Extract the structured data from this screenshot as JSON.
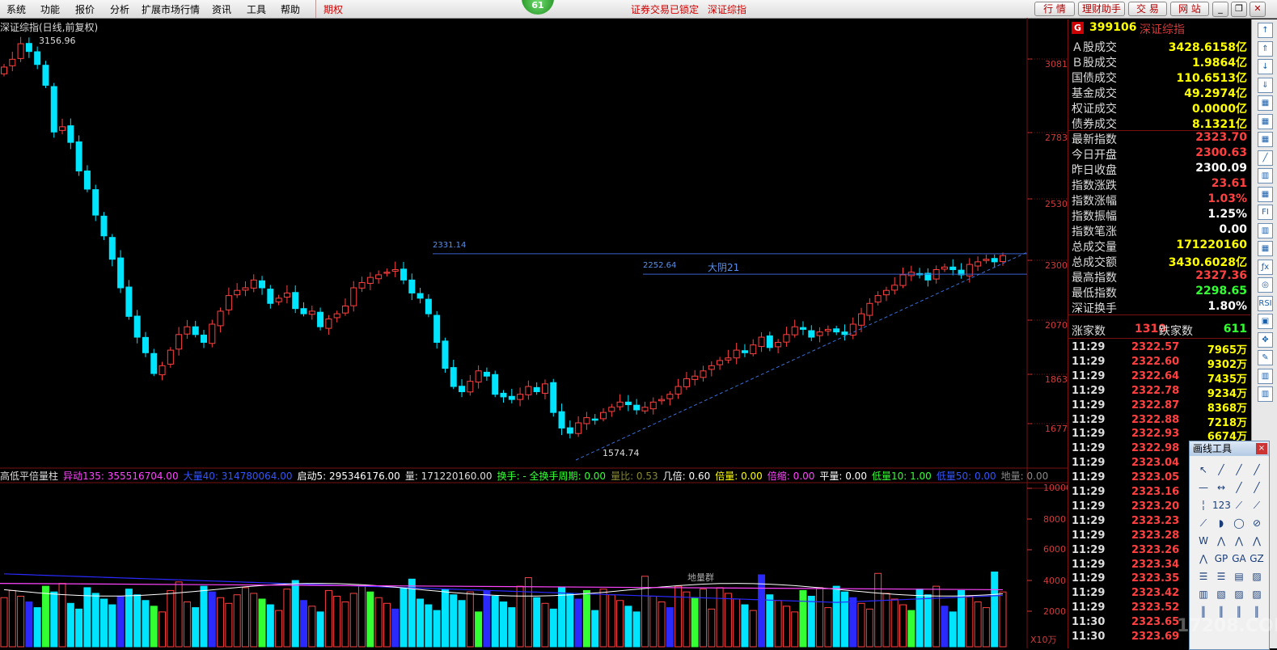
{
  "menu": {
    "items": [
      "系统",
      "功能",
      "报价",
      "分析",
      "扩展市场行情",
      "资讯",
      "工具",
      "帮助"
    ],
    "active_item": "期权",
    "badge": "61",
    "status_locked": "证券交易已锁定",
    "status_index": "深证综指",
    "buttons": [
      "行 情",
      "理财助手",
      "交 易",
      "网 站"
    ]
  },
  "chart": {
    "title": "深证综指(日线,前复权)",
    "max_label": "3156.96",
    "min_label": "1574.74",
    "level1_label": "2331.14",
    "level2_label": "2252.64",
    "pattern_label": "大阴21",
    "price_axis": [
      "3081",
      "2783",
      "2530",
      "2300",
      "2070",
      "1863",
      "1677"
    ],
    "colors": {
      "up": "#ff4040",
      "down": "#00e5ff",
      "level_line": "#3a5fcd",
      "trend_line": "#3a6fd8"
    }
  },
  "indicator": {
    "name": "高低平倍量柱",
    "items": [
      {
        "label": "异动135: 355516704.00",
        "color": "#ff44ff"
      },
      {
        "label": "大量40: 314780064.00",
        "color": "#3355ff"
      },
      {
        "label": "启动5: 295346176.00",
        "color": "#ffffff"
      },
      {
        "label": "量: 171220160.00",
        "color": "#dddddd"
      },
      {
        "label": "换手: - 全换手周期: 0.00",
        "color": "#33ff33"
      },
      {
        "label": "量比: 0.53",
        "color": "#888833"
      },
      {
        "label": "几倍: 0.60",
        "color": "#ffffff"
      },
      {
        "label": "倍量: 0.00",
        "color": "#ffff00"
      },
      {
        "label": "倍缩: 0.00",
        "color": "#ff44ff"
      },
      {
        "label": "平量: 0.00",
        "color": "#ffffff"
      },
      {
        "label": "低量10: 1.00",
        "color": "#33ff33"
      },
      {
        "label": "低量50: 0.00",
        "color": "#3355ff"
      },
      {
        "label": "地量: 0.00",
        "color": "#888888"
      }
    ],
    "volume_axis": [
      "10000",
      "8000",
      "6000",
      "4000",
      "2000"
    ],
    "unit_label": "X10万",
    "group_label": "地量群"
  },
  "quote": {
    "badge": "G",
    "code": "399106",
    "name": "深证综指",
    "rows": [
      {
        "label": "Ａ股成交",
        "value": "3428.6158亿",
        "color": "#ffff00"
      },
      {
        "label": "Ｂ股成交",
        "value": "1.9864亿",
        "color": "#ffff00"
      },
      {
        "label": "国债成交",
        "value": "110.6513亿",
        "color": "#ffff00"
      },
      {
        "label": "基金成交",
        "value": "49.2974亿",
        "color": "#ffff00"
      },
      {
        "label": "权证成交",
        "value": "0.0000亿",
        "color": "#ffff00"
      },
      {
        "label": "债券成交",
        "value": "8.1321亿",
        "color": "#ffff00"
      },
      {
        "label": "最新指数",
        "value": "2323.70",
        "color": "#ff4040"
      },
      {
        "label": "今日开盘",
        "value": "2300.63",
        "color": "#ff4040"
      },
      {
        "label": "昨日收盘",
        "value": "2300.09",
        "color": "#ffffff"
      },
      {
        "label": "指数涨跌",
        "value": "23.61",
        "color": "#ff4040"
      },
      {
        "label": "指数涨幅",
        "value": "1.03%",
        "color": "#ff4040"
      },
      {
        "label": "指数振幅",
        "value": "1.25%",
        "color": "#ffffff"
      },
      {
        "label": "指数笔涨",
        "value": "0.00",
        "color": "#ffffff"
      },
      {
        "label": "总成交量",
        "value": "171220160",
        "color": "#ffff00"
      },
      {
        "label": "总成交额",
        "value": "3430.6028亿",
        "color": "#ffff00"
      },
      {
        "label": "最高指数",
        "value": "2327.36",
        "color": "#ff4040"
      },
      {
        "label": "最低指数",
        "value": "2298.65",
        "color": "#33ff33"
      },
      {
        "label": "深证换手",
        "value": "1.80%",
        "color": "#ffffff"
      }
    ],
    "up_label": "涨家数",
    "up_count": "1310",
    "down_label": "跌家数",
    "down_count": "611",
    "ticks": [
      {
        "time": "11:29",
        "price": "2322.57",
        "vol": "7965万"
      },
      {
        "time": "11:29",
        "price": "2322.60",
        "vol": "9302万"
      },
      {
        "time": "11:29",
        "price": "2322.64",
        "vol": "7435万"
      },
      {
        "time": "11:29",
        "price": "2322.78",
        "vol": "9234万"
      },
      {
        "time": "11:29",
        "price": "2322.87",
        "vol": "8368万"
      },
      {
        "time": "11:29",
        "price": "2322.88",
        "vol": "7218万"
      },
      {
        "time": "11:29",
        "price": "2322.93",
        "vol": "6674万"
      },
      {
        "time": "11:29",
        "price": "2322.98",
        "vol": ""
      },
      {
        "time": "11:29",
        "price": "2323.04",
        "vol": ""
      },
      {
        "time": "11:29",
        "price": "2323.05",
        "vol": ""
      },
      {
        "time": "11:29",
        "price": "2323.16",
        "vol": ""
      },
      {
        "time": "11:29",
        "price": "2323.20",
        "vol": ""
      },
      {
        "time": "11:29",
        "price": "2323.23",
        "vol": ""
      },
      {
        "time": "11:29",
        "price": "2323.28",
        "vol": ""
      },
      {
        "time": "11:29",
        "price": "2323.26",
        "vol": ""
      },
      {
        "time": "11:29",
        "price": "2323.34",
        "vol": ""
      },
      {
        "time": "11:29",
        "price": "2323.35",
        "vol": ""
      },
      {
        "time": "11:29",
        "price": "2323.42",
        "vol": ""
      },
      {
        "time": "11:29",
        "price": "2323.52",
        "vol": ""
      },
      {
        "time": "11:30",
        "price": "2323.65",
        "vol": ""
      },
      {
        "time": "11:30",
        "price": "2323.69",
        "vol": ""
      }
    ]
  },
  "drawtools": {
    "title": "画线工具",
    "close": "×",
    "tools": [
      "↖",
      "╱",
      "╱",
      "╱",
      "—",
      "↔",
      "╱",
      "╱",
      "╎",
      "123",
      "⟋",
      "⟋",
      "⟋",
      "◗",
      "◯",
      "⊘",
      "W",
      "⋀",
      "⋀",
      "⋀",
      "⋀",
      "GP",
      "GA",
      "GZ",
      "☰",
      "☰",
      "▤",
      "▨",
      "▥",
      "▧",
      "▨",
      "▨",
      "║",
      "║",
      "║",
      "║"
    ]
  },
  "toolbar": {
    "icons": [
      "↑",
      "⇑",
      "↓",
      "⇓",
      "▦",
      "▦",
      "▦",
      "╱",
      "▥",
      "▦",
      "FI",
      "▥",
      "▦",
      "ƒx",
      "◎",
      "RSI",
      "▣",
      "✥",
      "✎",
      "▥",
      "▥"
    ]
  },
  "watermark": "17208.COM"
}
